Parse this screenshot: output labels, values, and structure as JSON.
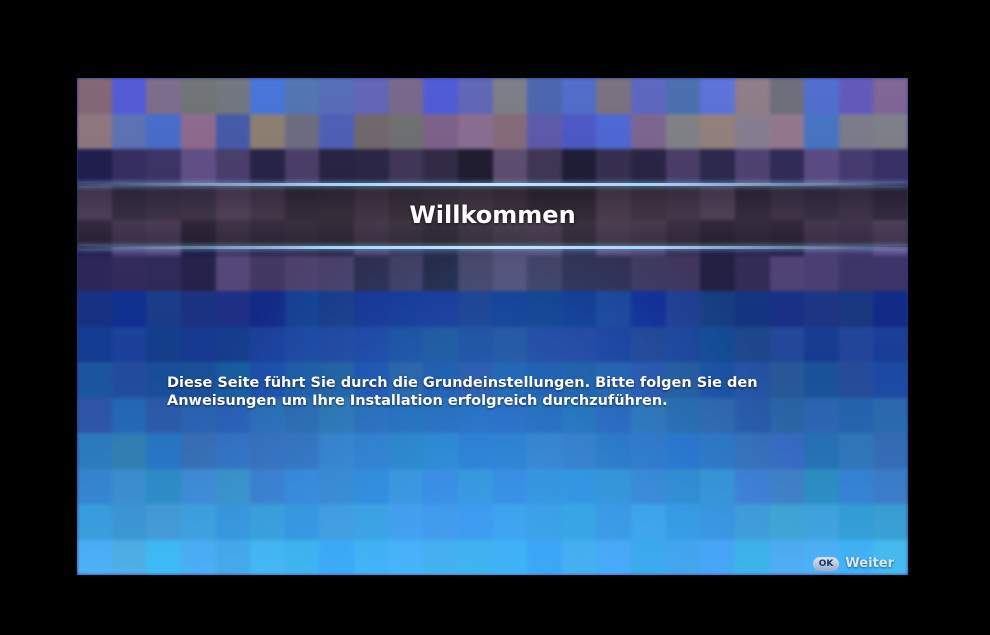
{
  "title": "Willkommen",
  "body": {
    "line1": "Diese Seite führt Sie durch die Grundeinstellungen. Bitte folgen Sie den",
    "line2": "Anweisungen um Ihre Installation erfolgreich durchzuführen."
  },
  "footer": {
    "ok_key": "OK",
    "next_label": "Weiter"
  },
  "colors": {
    "background": "#1a3a9a",
    "text": "#ffffff",
    "accent_line": "#b8dcff"
  }
}
